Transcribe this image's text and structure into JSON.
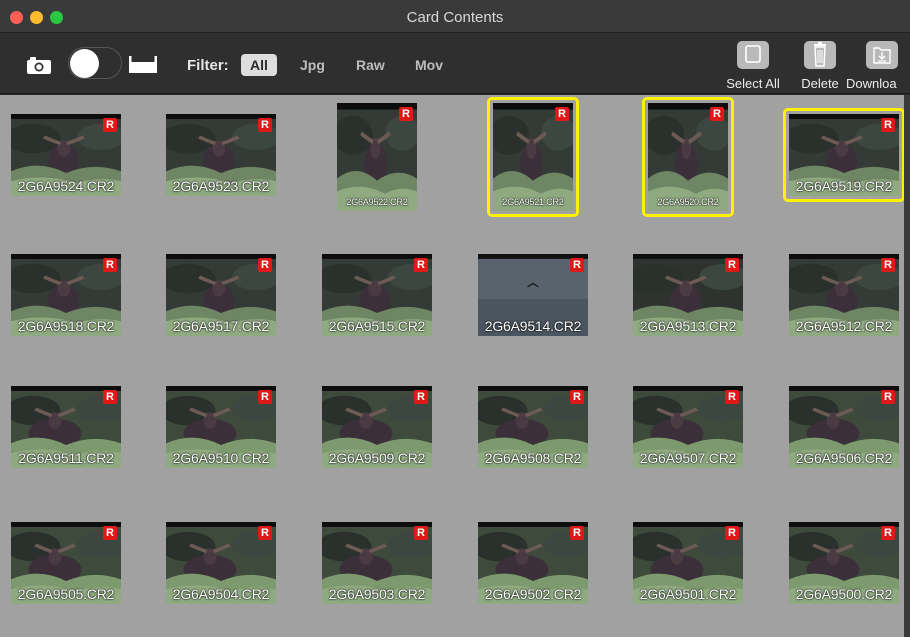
{
  "window": {
    "title": "Card Contents"
  },
  "toolbar": {
    "filter_label": "Filter:",
    "filters": [
      "All",
      "Jpg",
      "Raw",
      "Mov"
    ],
    "active_filter": "All",
    "select_all_label": "Select All",
    "delete_label": "Delete",
    "download_label": "Downloa"
  },
  "badge_text": "R",
  "thumbnails": [
    {
      "name": "2G6A9524.CR2",
      "selected": false,
      "orientation": "landscape",
      "scene": "moose-forest"
    },
    {
      "name": "2G6A9523.CR2",
      "selected": false,
      "orientation": "landscape",
      "scene": "moose-forest"
    },
    {
      "name": "2G6A9522.CR2",
      "selected": false,
      "orientation": "portrait",
      "scene": "moose-forest"
    },
    {
      "name": "2G6A9521.CR2",
      "selected": true,
      "orientation": "portrait",
      "scene": "moose-forest"
    },
    {
      "name": "2G6A9520.CR2",
      "selected": true,
      "orientation": "portrait",
      "scene": "moose-forest"
    },
    {
      "name": "2G6A9519.CR2",
      "selected": true,
      "orientation": "landscape",
      "scene": "moose-forest"
    },
    {
      "name": "2G6A9518.CR2",
      "selected": false,
      "orientation": "landscape",
      "scene": "moose-forest"
    },
    {
      "name": "2G6A9517.CR2",
      "selected": false,
      "orientation": "landscape",
      "scene": "moose-forest"
    },
    {
      "name": "2G6A9515.CR2",
      "selected": false,
      "orientation": "landscape",
      "scene": "moose-forest"
    },
    {
      "name": "2G6A9514.CR2",
      "selected": false,
      "orientation": "landscape",
      "scene": "sky-bird"
    },
    {
      "name": "2G6A9513.CR2",
      "selected": false,
      "orientation": "landscape",
      "scene": "moose-dark"
    },
    {
      "name": "2G6A9512.CR2",
      "selected": false,
      "orientation": "landscape",
      "scene": "moose-forest"
    },
    {
      "name": "2G6A9511.CR2",
      "selected": false,
      "orientation": "landscape",
      "scene": "moose-green"
    },
    {
      "name": "2G6A9510.CR2",
      "selected": false,
      "orientation": "landscape",
      "scene": "moose-green"
    },
    {
      "name": "2G6A9509.CR2",
      "selected": false,
      "orientation": "landscape",
      "scene": "moose-green"
    },
    {
      "name": "2G6A9508.CR2",
      "selected": false,
      "orientation": "landscape",
      "scene": "moose-green"
    },
    {
      "name": "2G6A9507.CR2",
      "selected": false,
      "orientation": "landscape",
      "scene": "moose-green"
    },
    {
      "name": "2G6A9506.CR2",
      "selected": false,
      "orientation": "landscape",
      "scene": "moose-green"
    },
    {
      "name": "2G6A9505.CR2",
      "selected": false,
      "orientation": "landscape",
      "scene": "moose-green"
    },
    {
      "name": "2G6A9504.CR2",
      "selected": false,
      "orientation": "landscape",
      "scene": "moose-green"
    },
    {
      "name": "2G6A9503.CR2",
      "selected": false,
      "orientation": "landscape",
      "scene": "moose-green"
    },
    {
      "name": "2G6A9502.CR2",
      "selected": false,
      "orientation": "landscape",
      "scene": "moose-green"
    },
    {
      "name": "2G6A9501.CR2",
      "selected": false,
      "orientation": "landscape",
      "scene": "moose-green"
    },
    {
      "name": "2G6A9500.CR2",
      "selected": false,
      "orientation": "landscape",
      "scene": "moose-green"
    }
  ],
  "colors": {
    "selection": "#fff200",
    "badge": "#e01818",
    "grid_background": "#a1a1a1"
  }
}
